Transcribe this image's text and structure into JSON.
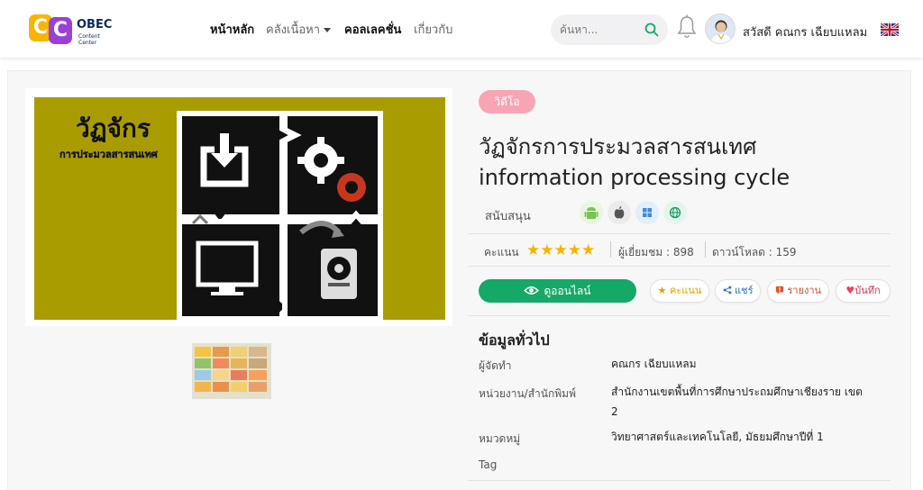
{
  "header": {
    "logo_letters": [
      "C",
      "C"
    ],
    "logo_text": "OBEC",
    "logo_sub": "Content Center",
    "nav": [
      {
        "label": "หน้าหลัก",
        "active": true
      },
      {
        "label": "คลังเนื้อหา",
        "dropdown": true
      },
      {
        "label": "คอลเลคชั่น",
        "active": true
      },
      {
        "label": "เกี่ยวกับ"
      }
    ],
    "search_placeholder": "ค้นหา...",
    "greeting": "สวัสดี คณกร เฉียบแหลม",
    "icons": [
      "search-icon",
      "bell-icon",
      "user-avatar",
      "uk-flag-icon"
    ]
  },
  "media": {
    "image_title": "วัฏจักร",
    "image_subtitle": "การประมวลสารสนเทศ"
  },
  "content": {
    "type_badge": "วิดีโอ",
    "title_line1": "วัฏจักรการประมวลสารสนเทศ",
    "title_line2": "information processing cycle",
    "support_label": "สนับสนุน",
    "platforms": [
      "android-icon",
      "apple-icon",
      "windows-icon",
      "web-icon"
    ],
    "score_label": "คะแนน",
    "stars": "★★★★★",
    "rating": 5,
    "views": "ผู้เยี่ยมชม : 898",
    "downloads": "ดาวน์โหลด : 159"
  },
  "actions": {
    "online_label": "ดูออนไลน์",
    "rate_label": "คะแนน",
    "share_label": "แชร์",
    "report_label": "รายงาน",
    "save_label": "บันทึก"
  },
  "info": {
    "heading": "ข้อมูลทั่วไป",
    "rows": [
      {
        "key": "ผู้จัดทำ",
        "value": "คณกร เฉียบแหลม"
      },
      {
        "key": "หน่วยงาน/สำนักพิมพ์",
        "value": "สำนักงานเขตพื้นที่การศึกษาประถมศึกษาเชียงราย เขต 2"
      },
      {
        "key": "หมวดหมู่",
        "value": "วิทยาศาสตร์และเทคโนโลยี, มัธยมศึกษาปีที่ 1"
      },
      {
        "key": "Tag",
        "value": ""
      }
    ]
  },
  "colors": {
    "accent_green": "#16a866",
    "badge_pink": "#f7a5b5",
    "star": "#f5b301",
    "image_bg": "#a89c00"
  }
}
